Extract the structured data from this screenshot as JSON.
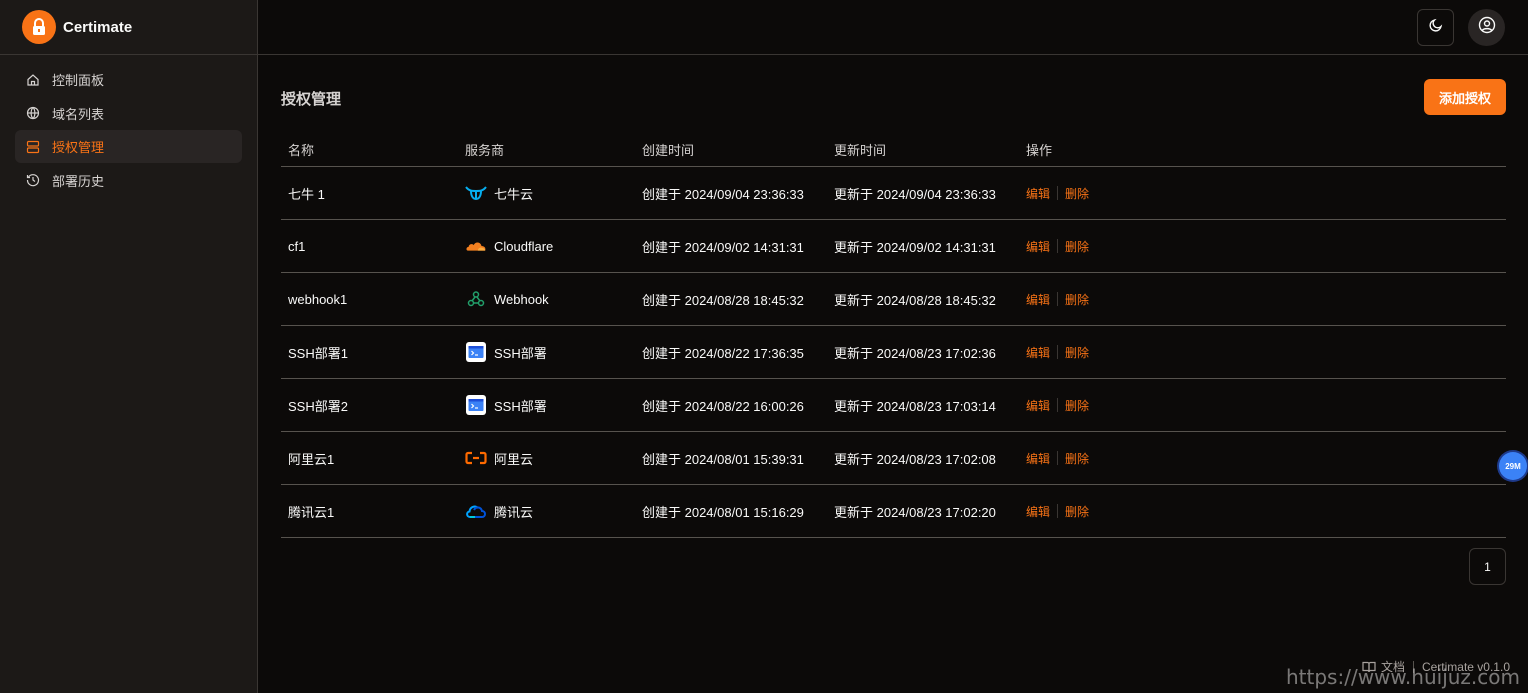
{
  "brand": {
    "name": "Certimate",
    "logo_color": "#f97316"
  },
  "nav": [
    {
      "label": "控制面板",
      "icon": "home-icon",
      "active": false
    },
    {
      "label": "域名列表",
      "icon": "globe-icon",
      "active": false
    },
    {
      "label": "授权管理",
      "icon": "server-icon",
      "active": true
    },
    {
      "label": "部署历史",
      "icon": "history-icon",
      "active": false
    }
  ],
  "page": {
    "title": "授权管理",
    "add_button": "添加授权"
  },
  "table": {
    "headers": [
      "名称",
      "服务商",
      "创建时间",
      "更新时间",
      "操作"
    ],
    "rows": [
      {
        "name": "七牛 1",
        "provider": "七牛云",
        "provider_icon": "qiniu-icon",
        "created": "创建于 2024/09/04 23:36:33",
        "updated": "更新于 2024/09/04 23:36:33"
      },
      {
        "name": "cf1",
        "provider": "Cloudflare",
        "provider_icon": "cloudflare-icon",
        "created": "创建于 2024/09/02 14:31:31",
        "updated": "更新于 2024/09/02 14:31:31"
      },
      {
        "name": "webhook1",
        "provider": "Webhook",
        "provider_icon": "webhook-icon",
        "created": "创建于 2024/08/28 18:45:32",
        "updated": "更新于 2024/08/28 18:45:32"
      },
      {
        "name": "SSH部署1",
        "provider": "SSH部署",
        "provider_icon": "ssh-icon",
        "created": "创建于 2024/08/22 17:36:35",
        "updated": "更新于 2024/08/23 17:02:36"
      },
      {
        "name": "SSH部署2",
        "provider": "SSH部署",
        "provider_icon": "ssh-icon",
        "created": "创建于 2024/08/22 16:00:26",
        "updated": "更新于 2024/08/23 17:03:14"
      },
      {
        "name": "阿里云1",
        "provider": "阿里云",
        "provider_icon": "aliyun-icon",
        "created": "创建于 2024/08/01 15:39:31",
        "updated": "更新于 2024/08/23 17:02:08"
      },
      {
        "name": "腾讯云1",
        "provider": "腾讯云",
        "provider_icon": "tencent-cloud-icon",
        "created": "创建于 2024/08/01 15:16:29",
        "updated": "更新于 2024/08/23 17:02:20"
      }
    ],
    "actions": {
      "edit": "编辑",
      "delete": "删除"
    }
  },
  "pagination": {
    "current_page": "1"
  },
  "footer": {
    "docs": "文档",
    "version": "Certimate v0.1.0"
  },
  "float_badge": "29M",
  "watermark": "https://www.huijuz.com",
  "colors": {
    "accent": "#f97316",
    "background": "#0c0a09",
    "sidebar": "#1c1917"
  }
}
